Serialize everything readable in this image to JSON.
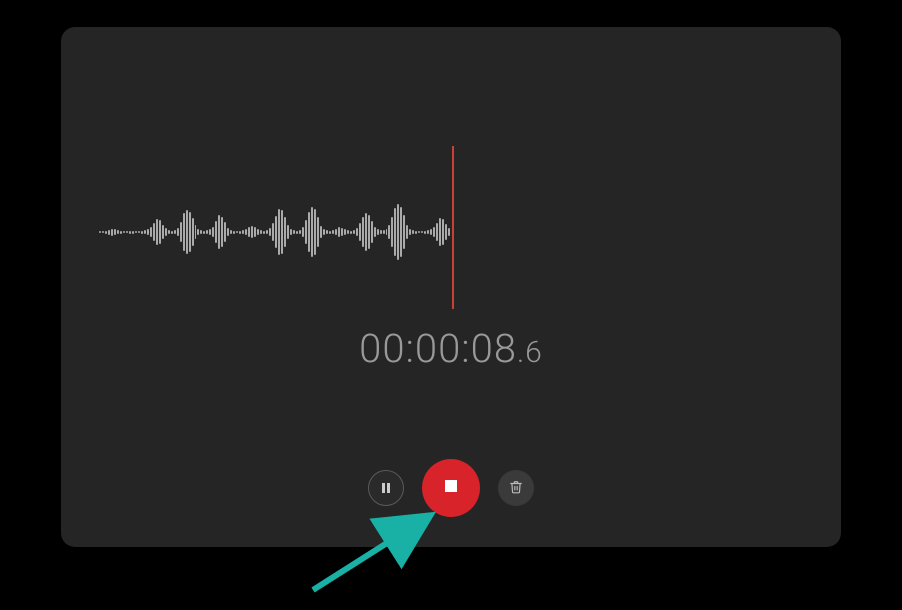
{
  "recorder": {
    "timeMain": "00:00:08",
    "timeFrac": ".6",
    "buttons": {
      "pause": "pause",
      "stop": "stop",
      "delete": "delete"
    }
  },
  "colors": {
    "accent": "#d8232a",
    "panel": "#252525",
    "background": "#000000",
    "annotation": "#19b0a6"
  },
  "waveform": {
    "amplitudes": [
      2,
      2,
      3,
      5,
      7,
      6,
      4,
      3,
      2,
      2,
      3,
      3,
      2,
      2,
      3,
      4,
      6,
      10,
      18,
      26,
      24,
      14,
      8,
      4,
      3,
      4,
      8,
      20,
      38,
      44,
      40,
      28,
      14,
      6,
      4,
      3,
      4,
      6,
      10,
      22,
      34,
      30,
      20,
      8,
      4,
      3,
      2,
      3,
      4,
      6,
      10,
      12,
      10,
      6,
      4,
      3,
      4,
      8,
      18,
      32,
      46,
      44,
      30,
      14,
      6,
      4,
      3,
      4,
      10,
      24,
      40,
      50,
      46,
      30,
      12,
      6,
      4,
      3,
      4,
      6,
      10,
      8,
      6,
      4,
      3,
      4,
      8,
      18,
      30,
      38,
      34,
      22,
      10,
      6,
      4,
      4,
      6,
      14,
      30,
      48,
      56,
      50,
      34,
      14,
      6,
      4,
      3,
      2,
      2,
      3,
      4,
      6,
      10,
      18,
      28,
      26,
      16,
      8
    ]
  },
  "annotation": {
    "target": "stop-button"
  }
}
